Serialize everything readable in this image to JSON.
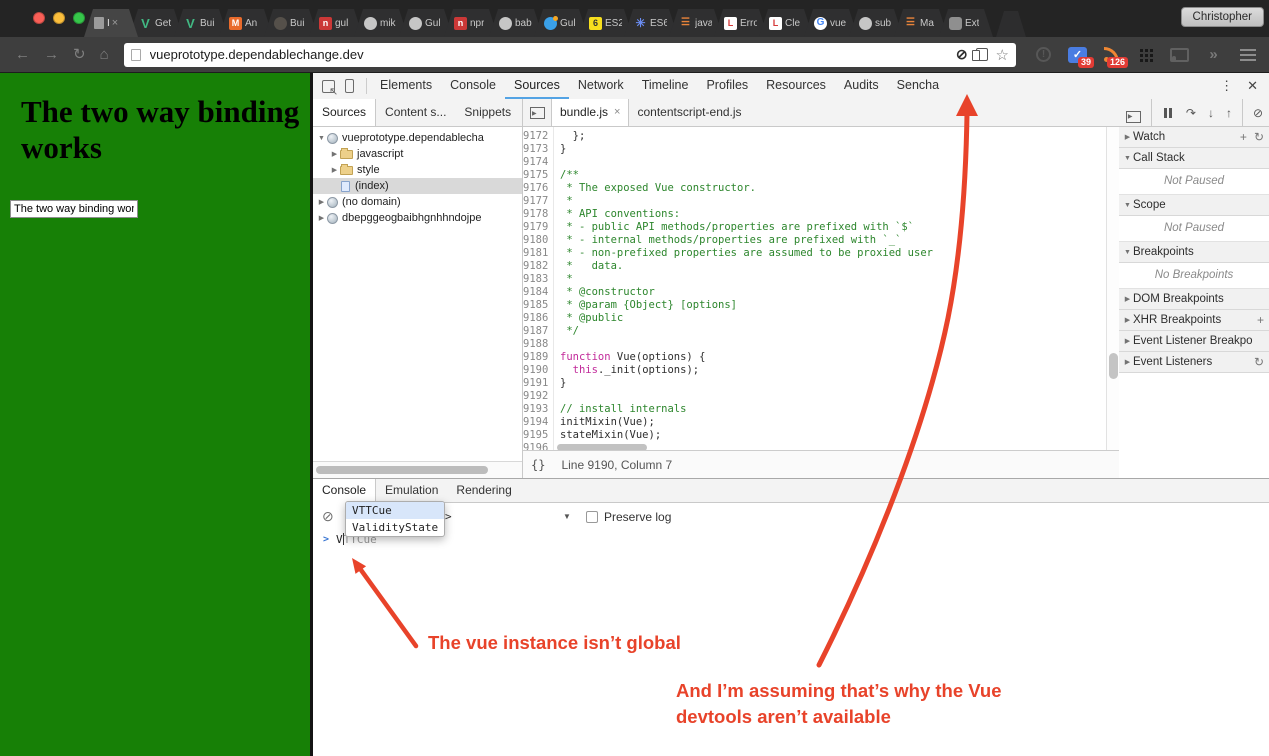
{
  "titlebar": {
    "profile": "Christopher",
    "tabs": [
      {
        "icon": "page",
        "label": "I",
        "active": true
      },
      {
        "icon": "vue",
        "label": "Get"
      },
      {
        "icon": "vue",
        "label": "Bui"
      },
      {
        "icon": "m-orange",
        "label": "An"
      },
      {
        "icon": "dark",
        "label": "Bui"
      },
      {
        "icon": "npm",
        "label": "gul"
      },
      {
        "icon": "github",
        "label": "mik"
      },
      {
        "icon": "github",
        "label": "Gul"
      },
      {
        "icon": "npm",
        "label": "npr"
      },
      {
        "icon": "github",
        "label": "bab"
      },
      {
        "icon": "blue-dot",
        "label": "Gul"
      },
      {
        "icon": "es6-yellow",
        "label": "ES2"
      },
      {
        "icon": "asterisk",
        "label": "ES6"
      },
      {
        "icon": "stackoverflow",
        "label": "java"
      },
      {
        "icon": "laracasts",
        "label": "Erro"
      },
      {
        "icon": "laracasts",
        "label": "Cle"
      },
      {
        "icon": "google",
        "label": "vue"
      },
      {
        "icon": "github",
        "label": "sub"
      },
      {
        "icon": "stackoverflow",
        "label": "Ma"
      },
      {
        "icon": "puzzle",
        "label": "Ext"
      }
    ]
  },
  "toolbar": {
    "url": "vueprototype.dependablechange.dev",
    "inbox_badge": "39",
    "rss_badge": "126",
    "info_glyph": "!",
    "inbox_glyph": "✓",
    "chevrons_glyph": "»"
  },
  "page": {
    "heading": "The two way binding works",
    "input_value": "The two way binding wor"
  },
  "devtools": {
    "panels": [
      "Elements",
      "Console",
      "Sources",
      "Network",
      "Timeline",
      "Profiles",
      "Resources",
      "Audits",
      "Sencha"
    ],
    "active_panel": "Sources",
    "sidebar_tabs": [
      "Sources",
      "Content s...",
      "Snippets"
    ],
    "editor_tabs": [
      {
        "label": "bundle.js",
        "closable": true,
        "active": true
      },
      {
        "label": "contentscript-end.js",
        "closable": false,
        "active": false
      }
    ],
    "file_tree": [
      {
        "label": "vueprototype.dependablecha",
        "icon": "globe",
        "caret": "down",
        "depth": 0,
        "selected": false
      },
      {
        "label": "javascript",
        "icon": "folder",
        "caret": "right",
        "depth": 1,
        "selected": false
      },
      {
        "label": "style",
        "icon": "folder",
        "caret": "right",
        "depth": 1,
        "selected": false
      },
      {
        "label": "(index)",
        "icon": "file",
        "caret": "none",
        "depth": 1,
        "selected": true
      },
      {
        "label": "(no domain)",
        "icon": "globe",
        "caret": "right",
        "depth": 0,
        "selected": false
      },
      {
        "label": "dbepggeogbaibhgnhhndojpe",
        "icon": "globe",
        "caret": "right",
        "depth": 0,
        "selected": false
      }
    ],
    "code": {
      "status": "Line 9190, Column 7",
      "brace_glyph": "{}",
      "lines": [
        {
          "n": "9172",
          "tokens": [
            {
              "c": "d",
              "t": "  };"
            }
          ]
        },
        {
          "n": "9173",
          "tokens": [
            {
              "c": "d",
              "t": "}"
            }
          ]
        },
        {
          "n": "9174",
          "tokens": []
        },
        {
          "n": "9175",
          "tokens": [
            {
              "c": "c",
              "t": "/**"
            }
          ]
        },
        {
          "n": "9176",
          "tokens": [
            {
              "c": "c",
              "t": " * The exposed Vue constructor."
            }
          ]
        },
        {
          "n": "9177",
          "tokens": [
            {
              "c": "c",
              "t": " *"
            }
          ]
        },
        {
          "n": "9178",
          "tokens": [
            {
              "c": "c",
              "t": " * API conventions:"
            }
          ]
        },
        {
          "n": "9179",
          "tokens": [
            {
              "c": "c",
              "t": " * - public API methods/properties are prefixed with `$`"
            }
          ]
        },
        {
          "n": "9180",
          "tokens": [
            {
              "c": "c",
              "t": " * - internal methods/properties are prefixed with `_`"
            }
          ]
        },
        {
          "n": "9181",
          "tokens": [
            {
              "c": "c",
              "t": " * - non-prefixed properties are assumed to be proxied user"
            }
          ]
        },
        {
          "n": "9182",
          "tokens": [
            {
              "c": "c",
              "t": " *   data."
            }
          ]
        },
        {
          "n": "9183",
          "tokens": [
            {
              "c": "c",
              "t": " *"
            }
          ]
        },
        {
          "n": "9184",
          "tokens": [
            {
              "c": "c",
              "t": " * @constructor"
            }
          ]
        },
        {
          "n": "9185",
          "tokens": [
            {
              "c": "c",
              "t": " * @param {Object} [options]"
            }
          ]
        },
        {
          "n": "9186",
          "tokens": [
            {
              "c": "c",
              "t": " * @public"
            }
          ]
        },
        {
          "n": "9187",
          "tokens": [
            {
              "c": "c",
              "t": " */"
            }
          ]
        },
        {
          "n": "9188",
          "tokens": []
        },
        {
          "n": "9189",
          "tokens": [
            {
              "c": "k",
              "t": "function"
            },
            {
              "c": "d",
              "t": " Vue(options) {"
            }
          ]
        },
        {
          "n": "9190",
          "tokens": [
            {
              "c": "d",
              "t": "  "
            },
            {
              "c": "k",
              "t": "this"
            },
            {
              "c": "d",
              "t": "._init(options);"
            }
          ]
        },
        {
          "n": "9191",
          "tokens": [
            {
              "c": "d",
              "t": "}"
            }
          ]
        },
        {
          "n": "9192",
          "tokens": []
        },
        {
          "n": "9193",
          "tokens": [
            {
              "c": "c",
              "t": "// install internals"
            }
          ]
        },
        {
          "n": "9194",
          "tokens": [
            {
              "c": "d",
              "t": "initMixin(Vue);"
            }
          ]
        },
        {
          "n": "9195",
          "tokens": [
            {
              "c": "d",
              "t": "stateMixin(Vue);"
            }
          ]
        },
        {
          "n": "9196",
          "tokens": []
        }
      ]
    },
    "debugger_panes": [
      {
        "label": "Watch",
        "collapsed": true,
        "actions": [
          "plus",
          "refresh"
        ]
      },
      {
        "label": "Call Stack",
        "collapsed": false,
        "body": "Not Paused"
      },
      {
        "label": "Scope",
        "collapsed": false,
        "body": "Not Paused"
      },
      {
        "label": "Breakpoints",
        "collapsed": false,
        "body": "No Breakpoints"
      },
      {
        "label": "DOM Breakpoints",
        "collapsed": true
      },
      {
        "label": "XHR Breakpoints",
        "collapsed": true,
        "actions": [
          "plus"
        ]
      },
      {
        "label": "Event Listener Breakpo",
        "collapsed": true
      },
      {
        "label": "Event Listeners",
        "collapsed": true,
        "actions": [
          "refresh"
        ]
      }
    ],
    "console": {
      "tabs": [
        "Console",
        "Emulation",
        "Rendering"
      ],
      "active_tab": "Console",
      "frame_caret": ">",
      "preserve_log_label": "Preserve log",
      "prompt_chevron": ">",
      "prompt_typed": "V",
      "prompt_suggestion": "TTCue",
      "autocomplete": [
        "VTTCue",
        "ValidityState"
      ]
    }
  },
  "annotations": {
    "color": "#e8432a",
    "note1": "The vue instance isn’t global",
    "note2_line1": "And I’m assuming that’s why the Vue",
    "note2_line2": "devtools aren’t available"
  }
}
